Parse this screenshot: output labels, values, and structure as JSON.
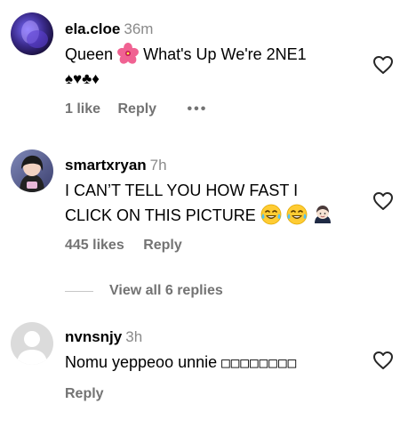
{
  "comments": [
    {
      "username": "ela.cloe",
      "time": "36m",
      "text_line1": "Queen",
      "text_line1_after": "What's Up We're 2NE1",
      "text_line2": "♠♥♣♦",
      "likes": "1 like",
      "reply": "Reply",
      "more": "•••"
    },
    {
      "username": "smartxryan",
      "time": "7h",
      "text_line1": "I CAN’T TELL YOU HOW FAST I",
      "text_line2": "CLICK ON THIS PICTURE",
      "likes": "445 likes",
      "reply": "Reply",
      "view_replies": "View all 6 replies"
    },
    {
      "username": "nvnsnjy",
      "time": "3h",
      "text_line1": "Nomu yeppeoo unnie",
      "text_line1_boxes": "□□□□□□□□",
      "reply": "Reply"
    }
  ],
  "icons": {
    "like": "heart-outline-icon",
    "flower": "hibiscus-emoji",
    "laugh": "face-with-tears-of-joy-emoji",
    "person": "person-emoji",
    "more": "more-horizontal-icon"
  },
  "colors": {
    "text": "#000000",
    "muted": "#737373",
    "timestamp": "#8a8a8a",
    "divider": "#c7c7c7"
  }
}
